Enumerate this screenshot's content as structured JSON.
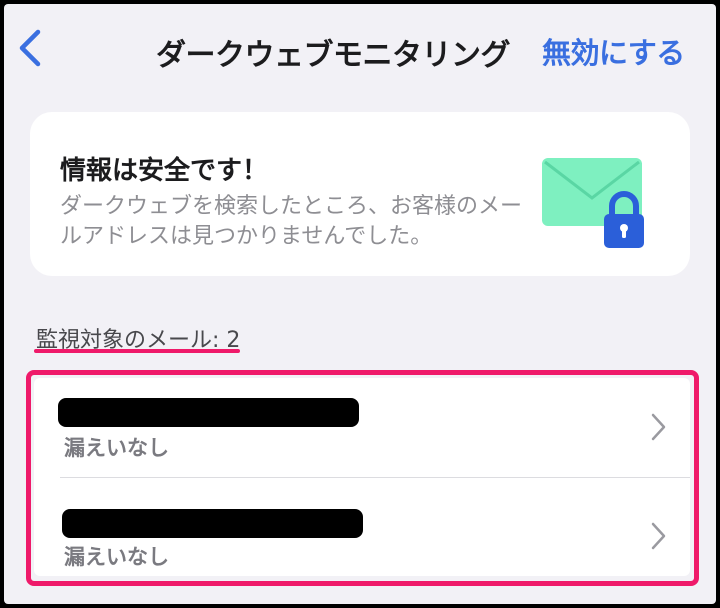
{
  "header": {
    "title": "ダークウェブモニタリング",
    "action_label": "無効にする",
    "back_icon": "chevron-left-icon"
  },
  "status_card": {
    "title": "情報は安全です！",
    "description": "ダークウェブを検索したところ、お客様のメールアドレスは見つかりませんでした。",
    "icon": "mail-lock-icon"
  },
  "monitored": {
    "label": "監視対象のメール: 2"
  },
  "emails": [
    {
      "status": "漏えいなし"
    },
    {
      "status": "漏えいなし"
    }
  ],
  "colors": {
    "accent_blue": "#3a6fe0",
    "highlight_pink": "#ef1a6a",
    "envelope_green": "#6ee7b0",
    "lock_blue": "#2b5fd9"
  }
}
